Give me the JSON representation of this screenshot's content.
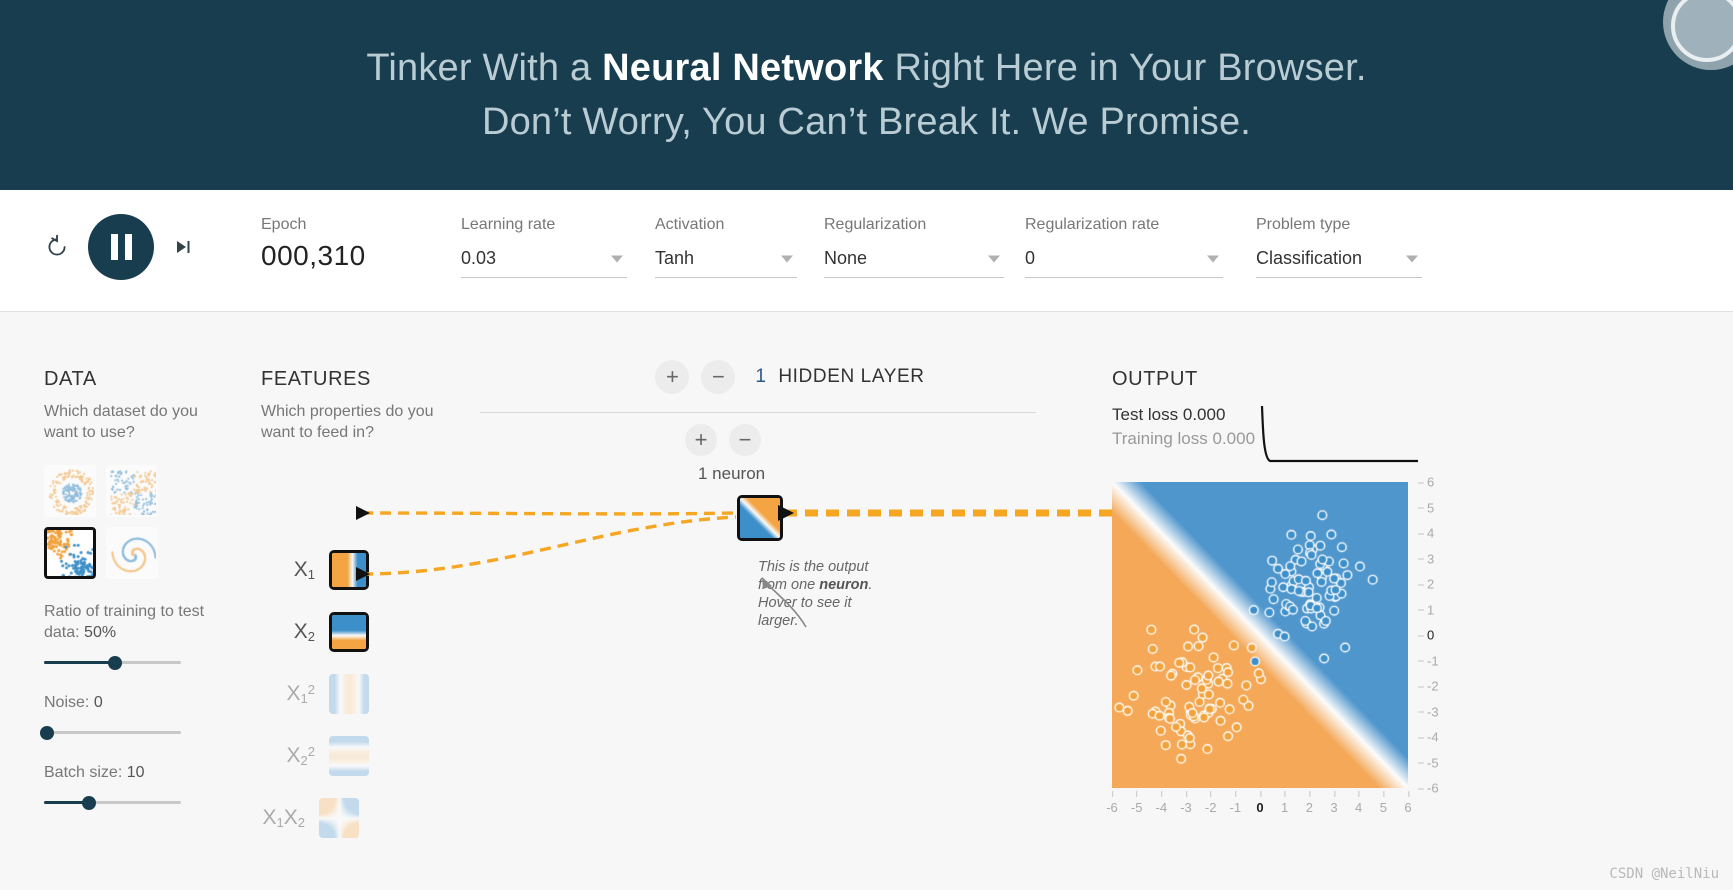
{
  "header": {
    "line1_pre": "Tinker With a ",
    "line1_bold": "Neural Network",
    "line1_post": " Right Here in Your Browser.",
    "line2": "Don’t Worry, You Can’t Break It. We Promise."
  },
  "controls": {
    "reset_icon": "reset-icon",
    "play_icon": "pause-icon",
    "step_icon": "step-forward-icon",
    "epoch_label": "Epoch",
    "epoch_value": "000,310",
    "learning_rate_label": "Learning rate",
    "learning_rate_value": "0.03",
    "activation_label": "Activation",
    "activation_value": "Tanh",
    "regularization_label": "Regularization",
    "regularization_value": "None",
    "regularization_rate_label": "Regularization rate",
    "regularization_rate_value": "0",
    "problem_type_label": "Problem type",
    "problem_type_value": "Classification"
  },
  "data": {
    "title": "DATA",
    "question": "Which dataset do you want to use?",
    "datasets": [
      {
        "name": "circle",
        "selected": false
      },
      {
        "name": "exclusive-or",
        "selected": false
      },
      {
        "name": "gaussian",
        "selected": true
      },
      {
        "name": "spiral",
        "selected": false
      }
    ],
    "ratio_label": "Ratio of training to test data:",
    "ratio_value": "50%",
    "ratio_percent": 50,
    "noise_label": "Noise:",
    "noise_value": "0",
    "noise_percent": 0,
    "batch_label": "Batch size:",
    "batch_value": "10",
    "batch_percent": 33
  },
  "features": {
    "title": "FEATURES",
    "question": "Which properties do you want to feed in?",
    "items": [
      {
        "name": "X1",
        "label_main": "X",
        "label_sub": "1",
        "label_sup": "",
        "active": true
      },
      {
        "name": "X2",
        "label_main": "X",
        "label_sub": "2",
        "label_sup": "",
        "active": true
      },
      {
        "name": "X1sq",
        "label_main": "X",
        "label_sub": "1",
        "label_sup": "2",
        "active": false
      },
      {
        "name": "X2sq",
        "label_main": "X",
        "label_sub": "2",
        "label_sup": "2",
        "active": false
      },
      {
        "name": "X1X2",
        "label_main": "X₁X",
        "label_sub": "2",
        "label_sup": "",
        "active": false
      }
    ]
  },
  "network": {
    "add_layer_label": "+",
    "remove_layer_label": "−",
    "layer_count": "1",
    "layers_text": "HIDDEN LAYER",
    "add_neuron_label": "+",
    "remove_neuron_label": "−",
    "neuron_count_text": "1 neuron",
    "callout_pre": "This is the output from one ",
    "callout_bold": "neuron",
    "callout_post": ". Hover to see it larger."
  },
  "output": {
    "title": "OUTPUT",
    "test_loss_label": "Test loss",
    "test_loss_value": "0.000",
    "training_loss_label": "Training loss",
    "training_loss_value": "0.000"
  },
  "watermark": "CSDN @NeilNiu",
  "colors": {
    "header_bg": "#183d4e",
    "positive_blue": "#3d8fc9",
    "negative_orange": "#f2a23c",
    "link_orange": "#f5a623",
    "accent_dark": "#183d4e"
  },
  "chart_data": {
    "type": "scatter",
    "title": "OUTPUT",
    "xlabel": "",
    "ylabel": "",
    "xlim": [
      -6,
      6
    ],
    "ylim": [
      -6,
      6
    ],
    "xticks": [
      -6,
      -5,
      -4,
      -3,
      -2,
      -1,
      0,
      1,
      2,
      3,
      4,
      5,
      6
    ],
    "yticks": [
      6,
      5,
      4,
      3,
      2,
      1,
      0,
      -1,
      -2,
      -3,
      -4,
      -5,
      -6
    ],
    "grid": false,
    "legend": "none",
    "background": {
      "kind": "decision-boundary",
      "description": "Linear diagonal boundary from upper-left to lower-right; blue region upper-right, orange region lower-left",
      "boundary_line": {
        "from": [
          -6,
          6
        ],
        "to": [
          6,
          -6
        ]
      },
      "positive_color": "#3d8fc9",
      "negative_color": "#f2a23c"
    },
    "series": [
      {
        "name": "Class +1 (blue)",
        "color": "#3d8fc9",
        "center": [
          2.0,
          2.0
        ],
        "count": 80,
        "spread": 1.1
      },
      {
        "name": "Class -1 (orange)",
        "color": "#f2a23c",
        "center": [
          -2.5,
          -2.3
        ],
        "count": 80,
        "spread": 1.1
      }
    ]
  }
}
